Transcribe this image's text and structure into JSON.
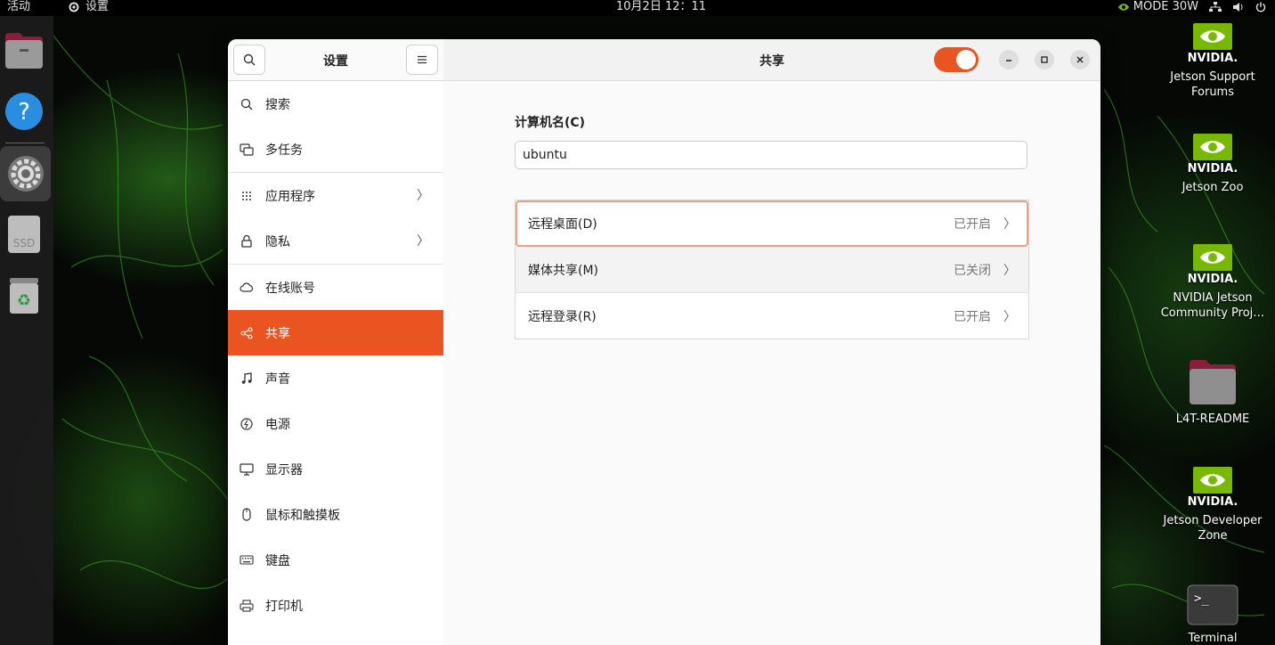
{
  "topbar": {
    "activities": "活动",
    "app_name": "设置",
    "clock": "10月2日  12：11",
    "power_mode": "MODE 30W"
  },
  "dock": {
    "items": [
      {
        "name": "files-icon"
      },
      {
        "name": "help-icon"
      },
      {
        "name": "settings-icon"
      },
      {
        "name": "ssd-drive-icon",
        "label": "SSD"
      },
      {
        "name": "trash-icon"
      }
    ]
  },
  "desktop_icons": [
    {
      "label": "Jetson Support Forums",
      "icon": "nvidia-logo",
      "logo_text": "NVIDIA."
    },
    {
      "label": "Jetson Zoo",
      "icon": "nvidia-logo",
      "logo_text": "NVIDIA."
    },
    {
      "label": "NVIDIA Jetson Community Proj…",
      "icon": "nvidia-logo",
      "logo_text": "NVIDIA."
    },
    {
      "label": "L4T-README",
      "icon": "folder-icon"
    },
    {
      "label": "Jetson Developer Zone",
      "icon": "nvidia-logo",
      "logo_text": "NVIDIA."
    },
    {
      "label": "Terminal",
      "icon": "terminal-icon"
    }
  ],
  "sidebar": {
    "title": "设置",
    "items": [
      {
        "label": "搜索",
        "icon": "search-icon"
      },
      {
        "label": "多任务",
        "icon": "multitasking-icon"
      },
      {
        "label": "应用程序",
        "icon": "apps-grid-icon",
        "chevron": true
      },
      {
        "label": "隐私",
        "icon": "lock-icon",
        "chevron": true
      },
      {
        "label": "在线账号",
        "icon": "cloud-icon"
      },
      {
        "label": "共享",
        "icon": "share-icon",
        "selected": true
      },
      {
        "label": "声音",
        "icon": "music-note-icon"
      },
      {
        "label": "电源",
        "icon": "power-icon"
      },
      {
        "label": "显示器",
        "icon": "display-icon"
      },
      {
        "label": "鼠标和触摸板",
        "icon": "mouse-icon"
      },
      {
        "label": "键盘",
        "icon": "keyboard-icon"
      },
      {
        "label": "打印机",
        "icon": "printer-icon"
      }
    ]
  },
  "main": {
    "title": "共享",
    "sharing_enabled": true,
    "hostname_label": "计算机名(C)",
    "hostname_value": "ubuntu",
    "rows": [
      {
        "label": "远程桌面(D)",
        "status": "已开启"
      },
      {
        "label": "媒体共享(M)",
        "status": "已关闭"
      },
      {
        "label": "远程登录(R)",
        "status": "已开启"
      }
    ]
  },
  "colors": {
    "accent": "#e95420",
    "nvidia_green": "#76b900"
  }
}
